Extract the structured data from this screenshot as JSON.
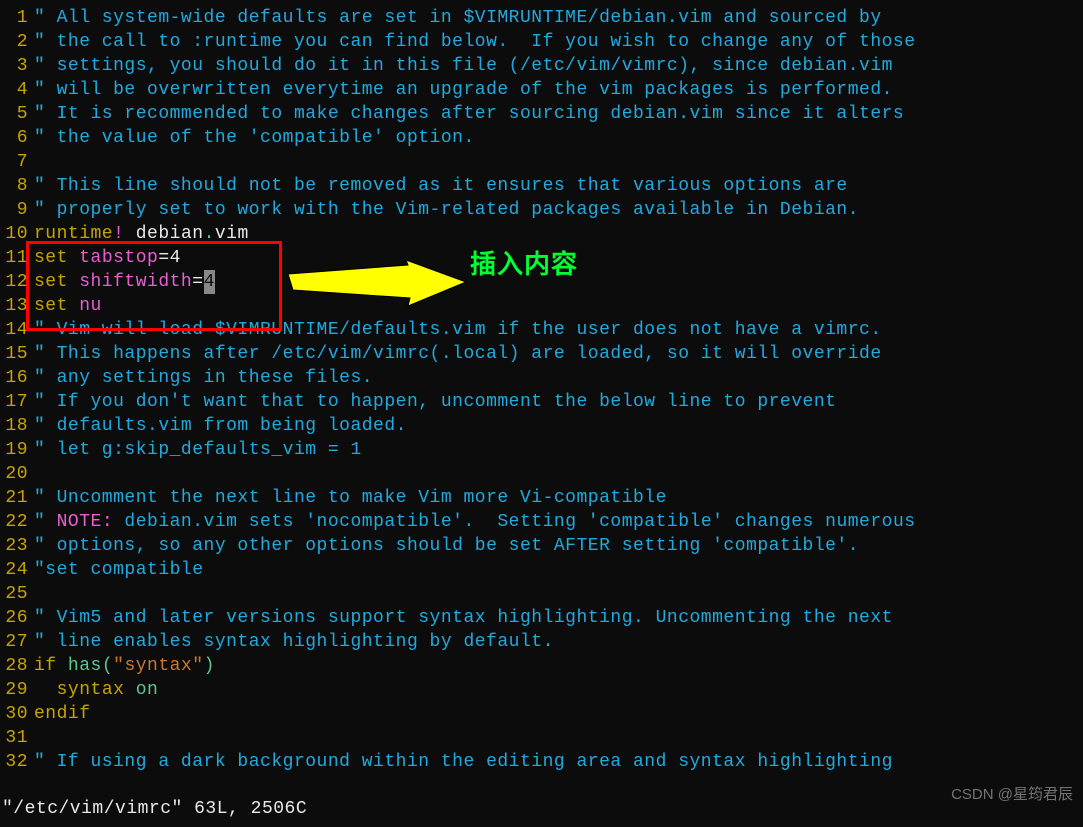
{
  "annotation": {
    "label": "插入内容"
  },
  "status_line": "\"/etc/vim/vimrc\" 63L, 2506C",
  "watermark": "CSDN @星筠君辰",
  "lines": [
    {
      "n": "1",
      "segs": [
        {
          "c": "comment",
          "t": "\" All system-wide defaults are set in $VIMRUNTIME/debian.vim and sourced by"
        }
      ]
    },
    {
      "n": "2",
      "segs": [
        {
          "c": "comment",
          "t": "\" the call to :runtime you can find below.  If you wish to change any of those"
        }
      ]
    },
    {
      "n": "3",
      "segs": [
        {
          "c": "comment",
          "t": "\" settings, you should do it in this file (/etc/vim/vimrc), since debian.vim"
        }
      ]
    },
    {
      "n": "4",
      "segs": [
        {
          "c": "comment",
          "t": "\" will be overwritten everytime an upgrade of the vim packages is performed."
        }
      ]
    },
    {
      "n": "5",
      "segs": [
        {
          "c": "comment",
          "t": "\" It is recommended to make changes after sourcing debian.vim since it alters"
        }
      ]
    },
    {
      "n": "6",
      "segs": [
        {
          "c": "comment",
          "t": "\" the value of the 'compatible' option."
        }
      ]
    },
    {
      "n": "7",
      "segs": []
    },
    {
      "n": "8",
      "segs": [
        {
          "c": "comment",
          "t": "\" This line should not be removed as it ensures that various options are"
        }
      ]
    },
    {
      "n": "9",
      "segs": [
        {
          "c": "comment",
          "t": "\" properly set to work with the Vim-related packages available in Debian."
        }
      ]
    },
    {
      "n": "10",
      "segs": [
        {
          "c": "runtime",
          "t": "runtime"
        },
        {
          "c": "bang",
          "t": "!"
        },
        {
          "c": "ident",
          "t": " debian"
        },
        {
          "c": "dot",
          "t": "."
        },
        {
          "c": "ident",
          "t": "vim"
        }
      ]
    },
    {
      "n": "11",
      "segs": [
        {
          "c": "kw-set",
          "t": "set"
        },
        {
          "c": "white",
          "t": " "
        },
        {
          "c": "option",
          "t": "tabstop"
        },
        {
          "c": "white",
          "t": "=4"
        }
      ]
    },
    {
      "n": "12",
      "segs": [
        {
          "c": "kw-set",
          "t": "set"
        },
        {
          "c": "white",
          "t": " "
        },
        {
          "c": "option",
          "t": "shiftwidth"
        },
        {
          "c": "white",
          "t": "="
        },
        {
          "c": "cursor",
          "t": "4"
        }
      ]
    },
    {
      "n": "13",
      "segs": [
        {
          "c": "kw-set",
          "t": "set"
        },
        {
          "c": "white",
          "t": " "
        },
        {
          "c": "option",
          "t": "nu"
        }
      ]
    },
    {
      "n": "14",
      "segs": [
        {
          "c": "comment",
          "t": "\" Vim will load $VIMRUNTIME/defaults.vim if the user does not have a vimrc."
        }
      ]
    },
    {
      "n": "15",
      "segs": [
        {
          "c": "comment",
          "t": "\" This happens after /etc/vim/vimrc(.local) are loaded, so it will override"
        }
      ]
    },
    {
      "n": "16",
      "segs": [
        {
          "c": "comment",
          "t": "\" any settings in these files."
        }
      ]
    },
    {
      "n": "17",
      "segs": [
        {
          "c": "comment",
          "t": "\" If you don't want that to happen, uncomment the below line to prevent"
        }
      ]
    },
    {
      "n": "18",
      "segs": [
        {
          "c": "comment",
          "t": "\" defaults.vim from being loaded."
        }
      ]
    },
    {
      "n": "19",
      "segs": [
        {
          "c": "comment",
          "t": "\" let g:skip_defaults_vim = 1"
        }
      ]
    },
    {
      "n": "20",
      "segs": []
    },
    {
      "n": "21",
      "segs": [
        {
          "c": "comment",
          "t": "\" Uncomment the next line to make Vim more Vi-compatible"
        }
      ]
    },
    {
      "n": "22",
      "segs": [
        {
          "c": "comment",
          "t": "\" "
        },
        {
          "c": "note-tag",
          "t": "NOTE:"
        },
        {
          "c": "comment",
          "t": " debian.vim sets 'nocompatible'.  Setting 'compatible' changes numerous"
        }
      ]
    },
    {
      "n": "23",
      "segs": [
        {
          "c": "comment",
          "t": "\" options, so any other options should be set AFTER setting 'compatible'."
        }
      ]
    },
    {
      "n": "24",
      "segs": [
        {
          "c": "comment",
          "t": "\"set compatible"
        }
      ]
    },
    {
      "n": "25",
      "segs": []
    },
    {
      "n": "26",
      "segs": [
        {
          "c": "comment",
          "t": "\" Vim5 and later versions support syntax highlighting. Uncommenting the next"
        }
      ]
    },
    {
      "n": "27",
      "segs": [
        {
          "c": "comment",
          "t": "\" line enables syntax highlighting by default."
        }
      ]
    },
    {
      "n": "28",
      "segs": [
        {
          "c": "kw-ctrl",
          "t": "if"
        },
        {
          "c": "white",
          "t": " "
        },
        {
          "c": "func",
          "t": "has"
        },
        {
          "c": "paren",
          "t": "("
        },
        {
          "c": "str",
          "t": "\"syntax\""
        },
        {
          "c": "paren",
          "t": ")"
        }
      ]
    },
    {
      "n": "29",
      "segs": [
        {
          "c": "white",
          "t": "  "
        },
        {
          "c": "kw-ctrl",
          "t": "syntax"
        },
        {
          "c": "white",
          "t": " "
        },
        {
          "c": "on-green",
          "t": "on"
        }
      ]
    },
    {
      "n": "30",
      "segs": [
        {
          "c": "kw-ctrl",
          "t": "endif"
        }
      ]
    },
    {
      "n": "31",
      "segs": []
    },
    {
      "n": "32",
      "segs": [
        {
          "c": "comment",
          "t": "\" If using a dark background within the editing area and syntax highlighting"
        }
      ]
    }
  ]
}
